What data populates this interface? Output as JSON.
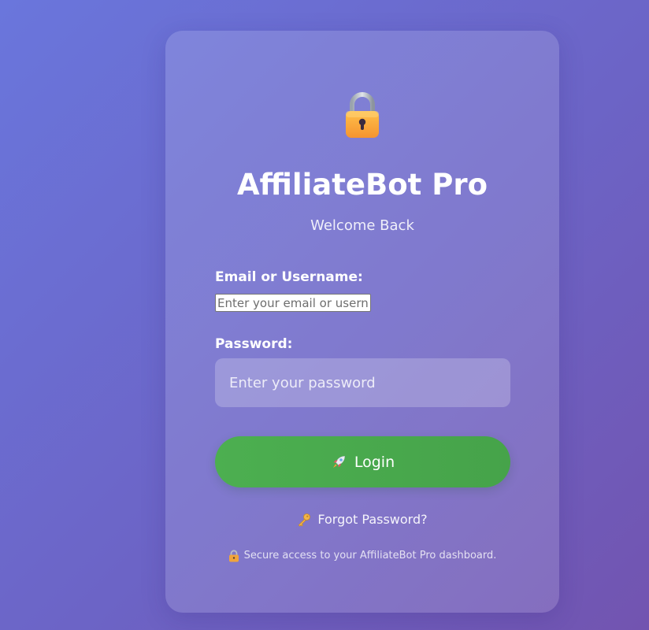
{
  "app": {
    "title": "AffiliateBot Pro",
    "subtitle": "Welcome Back"
  },
  "form": {
    "email_label": "Email or Username:",
    "email_placeholder": "Enter your email or username",
    "email_value": "",
    "password_label": "Password:",
    "password_placeholder": "Enter your password",
    "password_value": "",
    "login_label": "Login",
    "login_icon": "rocket-icon",
    "forgot_label": "Forgot Password?",
    "forgot_icon": "key-icon"
  },
  "footer": {
    "secure_text": "Secure access to your AffiliateBot Pro dashboard.",
    "secure_icon": "lock-icon"
  },
  "header": {
    "icon": "padlock-icon"
  },
  "colors": {
    "accent": "#4caf50",
    "background_start": "#6a76dc",
    "background_end": "#7254b0"
  }
}
